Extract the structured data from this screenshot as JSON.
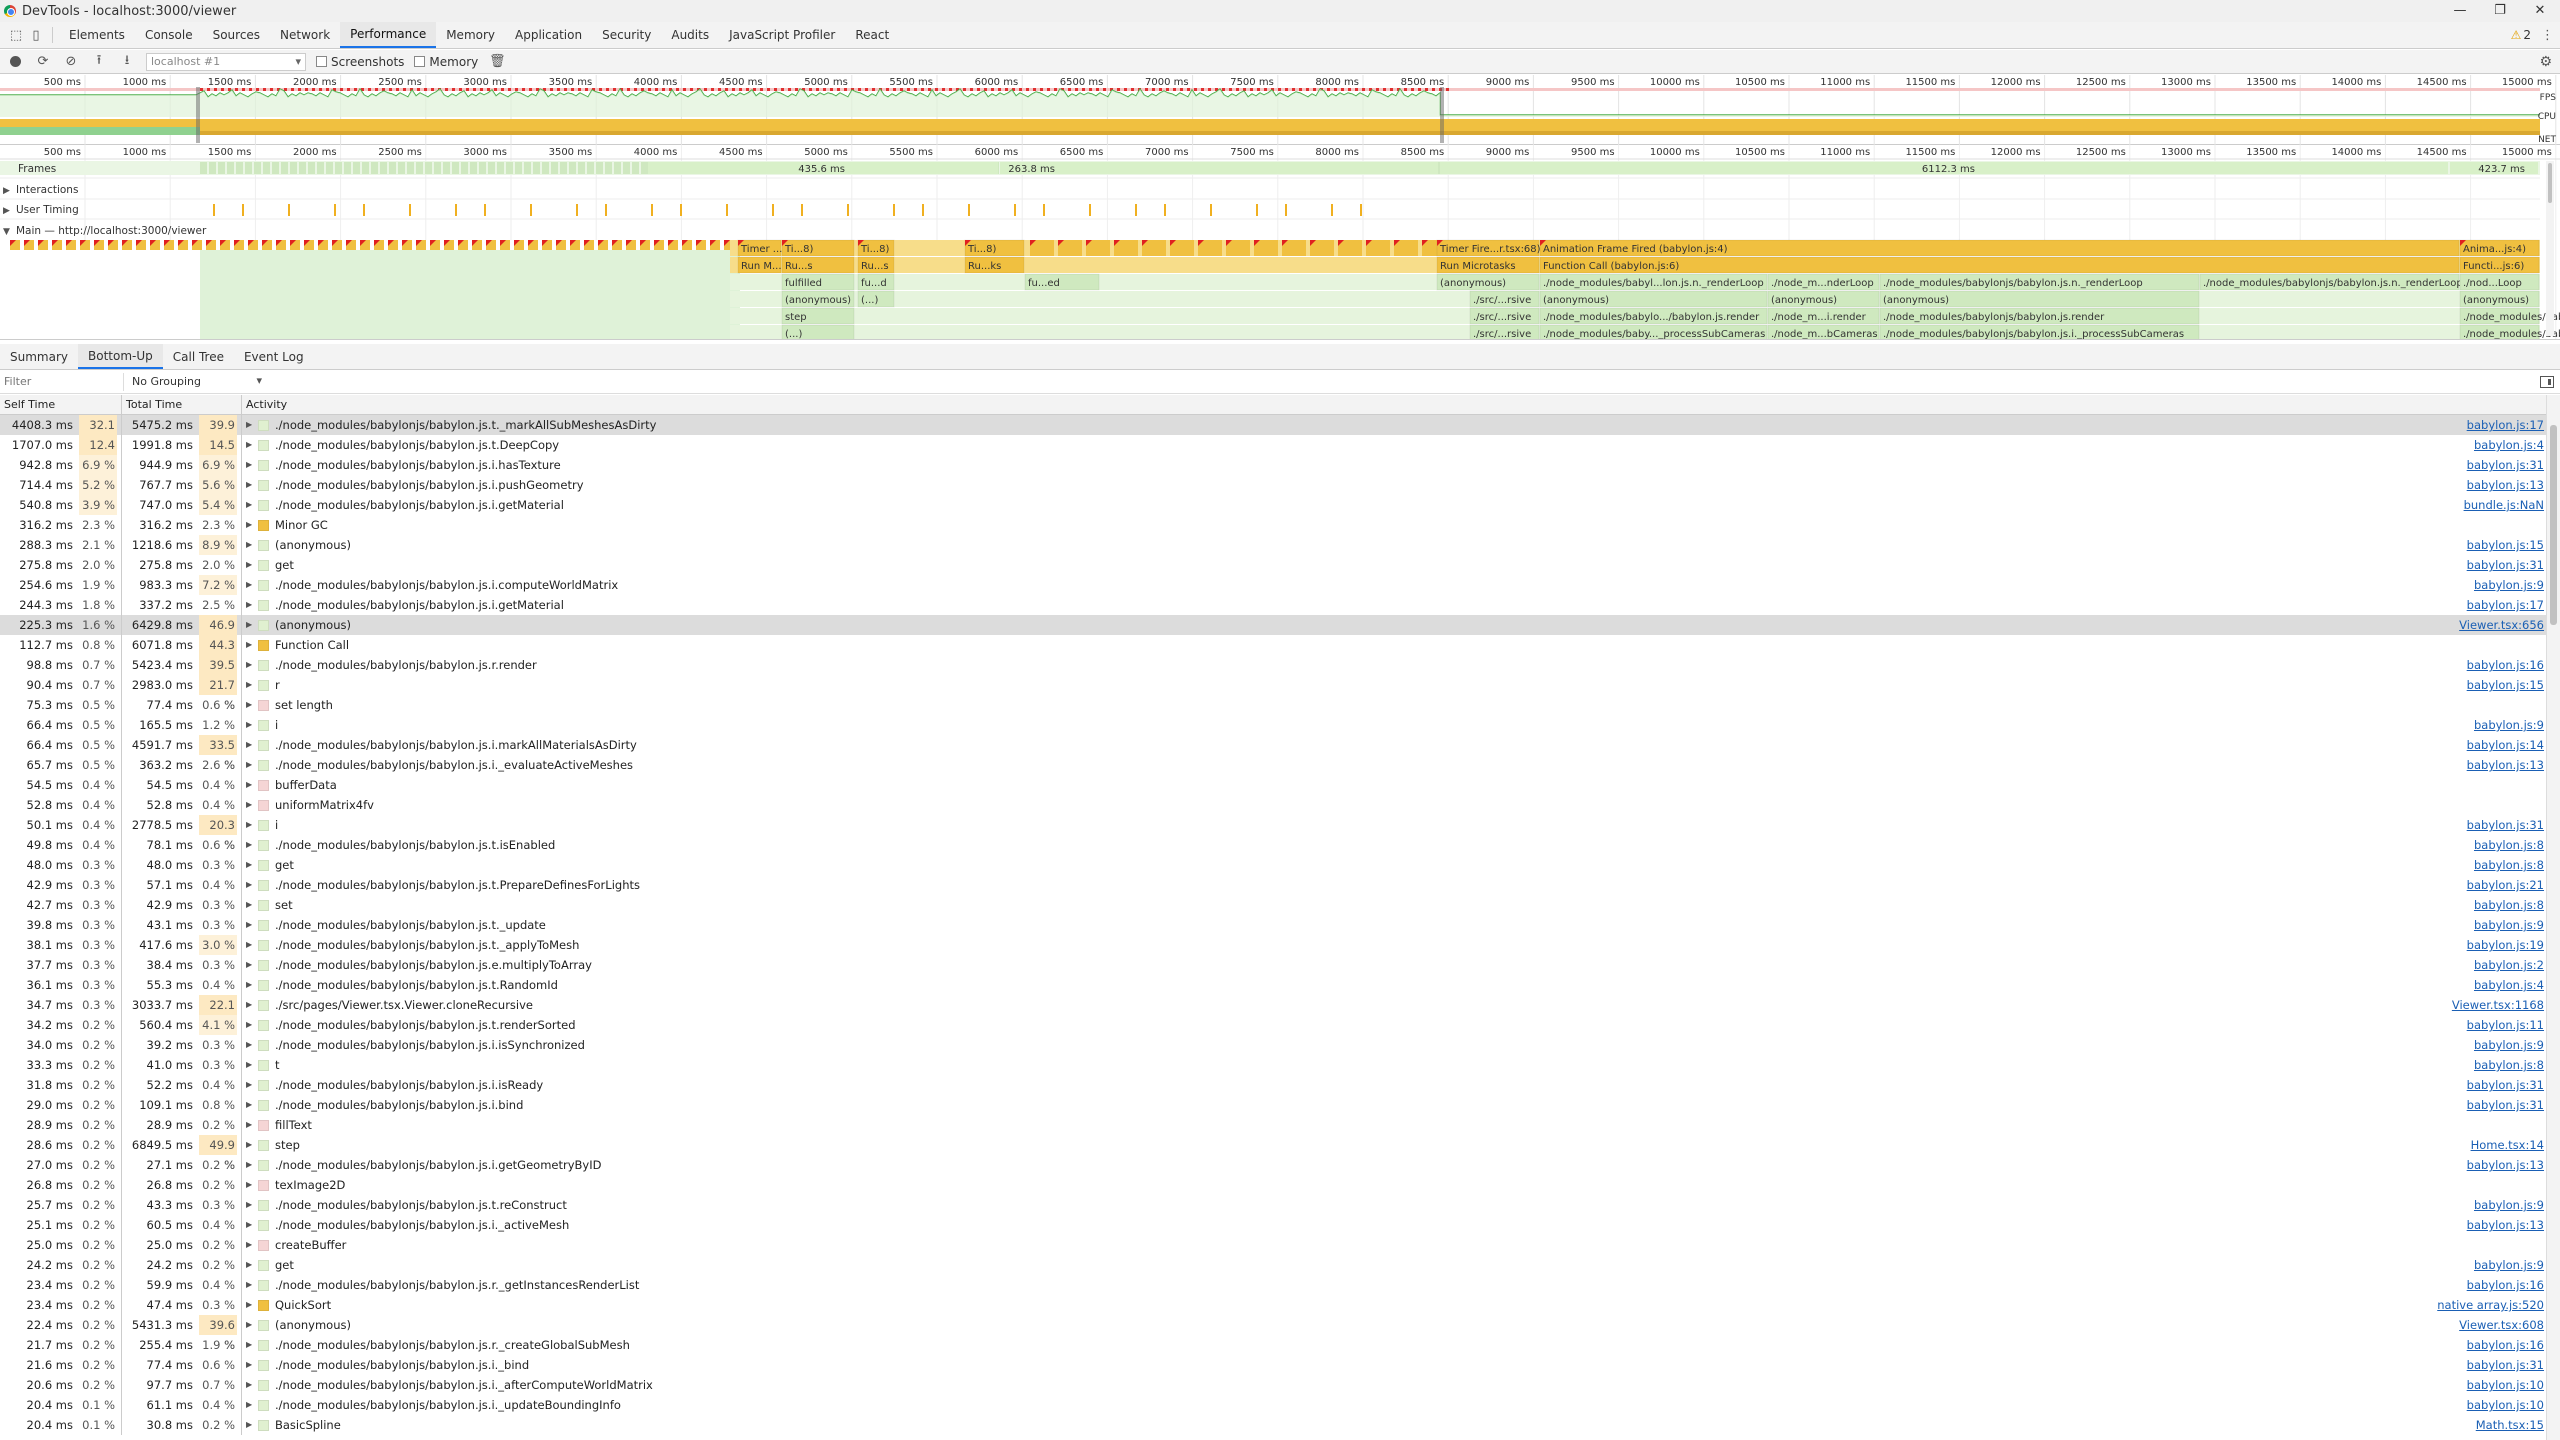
{
  "window": {
    "title": "DevTools - localhost:3000/viewer",
    "min": "—",
    "max": "❐",
    "close": "✕"
  },
  "tabs": [
    "Elements",
    "Console",
    "Sources",
    "Network",
    "Performance",
    "Memory",
    "Application",
    "Security",
    "Audits",
    "JavaScript Profiler",
    "React"
  ],
  "active_tab": "Performance",
  "warnings_count": "2",
  "toolbar": {
    "profile_select": "localhost #1",
    "screenshots_label": "Screenshots",
    "memory_label": "Memory"
  },
  "overview": {
    "ticks": [
      "500 ms",
      "1000 ms",
      "1500 ms",
      "2000 ms",
      "2500 ms",
      "3000 ms",
      "3500 ms",
      "4000 ms",
      "4500 ms",
      "5000 ms",
      "5500 ms",
      "6000 ms",
      "6500 ms",
      "7000 ms",
      "7500 ms",
      "8000 ms",
      "8500 ms",
      "9000 ms",
      "9500 ms",
      "10000 ms",
      "10500 ms",
      "11000 ms",
      "11500 ms",
      "12000 ms",
      "12500 ms",
      "13000 ms",
      "13500 ms",
      "14000 ms",
      "14500 ms",
      "15000 ms"
    ],
    "lanes": [
      "FPS",
      "CPU",
      "NET"
    ]
  },
  "timeline": {
    "ticks": [
      "500 ms",
      "1000 ms",
      "1500 ms",
      "2000 ms",
      "2500 ms",
      "3000 ms",
      "3500 ms",
      "4000 ms",
      "4500 ms",
      "5000 ms",
      "5500 ms",
      "6000 ms",
      "6500 ms",
      "7000 ms",
      "7500 ms",
      "8000 ms",
      "8500 ms",
      "9000 ms",
      "9500 ms",
      "10000 ms",
      "10500 ms",
      "11000 ms",
      "11500 ms",
      "12000 ms",
      "12500 ms",
      "13000 ms",
      "13500 ms",
      "14000 ms",
      "14500 ms",
      "15000 ms"
    ],
    "tracks": [
      "Frames",
      "Interactions",
      "User Timing",
      "Main — http://localhost:3000/viewer"
    ],
    "frame_labels": [
      "435.6 ms",
      "263.8 ms",
      "6112.3 ms",
      "423.7 ms"
    ],
    "flame_rows": [
      [
        "Timer ...ic68",
        "Ti...8)",
        "Ti...8)",
        "Ti...8)",
        "Timer Fire...r.tsx:68)",
        "Animation Frame Fired (babylon.js:4)",
        "Anima...js:4)"
      ],
      [
        "Run M...asks",
        "Ru...s",
        "Ru...s",
        "Ru...ks",
        "Run Microtasks",
        "Function Call (babylon.js:6)",
        "Functi...js:6)"
      ],
      [
        "fulfilled",
        "fu...d",
        "fu...ed",
        "(anonymous)",
        "./node_modules/babyl...lon.js.n._renderLoop",
        "./node_m...nderLoop",
        "./node_modules/babylonjs/babylon.js.n._renderLoop",
        "./node_modules/babylonjs/babylon.js.n._renderLoop",
        "./nod...Loop"
      ],
      [
        "(anonymous)",
        "(...)",
        "./src/...rsive",
        "(anonymous)",
        "(anonymous)",
        "(anonymous)",
        "(anonymous)",
        "(anon...ous)"
      ],
      [
        "step",
        "./src/...rsive",
        "./node_modules/babylo.../babylon.js.render",
        "./node_m...i.render",
        "./node_modules/babylonjs/babylon.js.render",
        "./node_modules/babylonjs/babylon.js.render",
        "./nod...nder"
      ],
      [
        "(...)",
        "./src/...rsive",
        "./node_modules/baby..._processSubCameras",
        "./node_m...bCameras",
        "./node_modules/babylonjs/babylon.js.i._processSubCameras",
        "./node_modules/babylonjs/babylon.js.i._processSubCameras",
        "./nod...eras"
      ]
    ]
  },
  "bottom_tabs": [
    "Summary",
    "Bottom-Up",
    "Call Tree",
    "Event Log"
  ],
  "active_bottom_tab": "Bottom-Up",
  "filter": {
    "placeholder": "Filter",
    "grouping": "No Grouping"
  },
  "table": {
    "headers": {
      "self": "Self Time",
      "total": "Total Time",
      "activity": "Activity"
    },
    "rows": [
      {
        "self": "4408.3 ms",
        "self_pct": "32.1 %",
        "total": "5475.2 ms",
        "total_pct": "39.9 %",
        "activity": "./node_modules/babylonjs/babylon.js.t._markAllSubMeshesAsDirty",
        "link": "babylon.js:17",
        "color": "#e0f0d0",
        "selected": true
      },
      {
        "self": "1707.0 ms",
        "self_pct": "12.4 %",
        "total": "1991.8 ms",
        "total_pct": "14.5 %",
        "activity": "./node_modules/babylonjs/babylon.js.t.DeepCopy",
        "link": "babylon.js:4",
        "color": "#e0f0d0"
      },
      {
        "self": "942.8 ms",
        "self_pct": "6.9 %",
        "total": "944.9 ms",
        "total_pct": "6.9 %",
        "activity": "./node_modules/babylonjs/babylon.js.i.hasTexture",
        "link": "babylon.js:31",
        "color": "#e0f0d0"
      },
      {
        "self": "714.4 ms",
        "self_pct": "5.2 %",
        "total": "767.7 ms",
        "total_pct": "5.6 %",
        "activity": "./node_modules/babylonjs/babylon.js.i.pushGeometry",
        "link": "babylon.js:13",
        "color": "#e0f0d0"
      },
      {
        "self": "540.8 ms",
        "self_pct": "3.9 %",
        "total": "747.0 ms",
        "total_pct": "5.4 %",
        "activity": "./node_modules/babylonjs/babylon.js.i.getMaterial",
        "link": "bundle.js:NaN",
        "color": "#e0f0d0"
      },
      {
        "self": "316.2 ms",
        "self_pct": "2.3 %",
        "total": "316.2 ms",
        "total_pct": "2.3 %",
        "activity": "Minor GC",
        "link": "",
        "color": "#f0c040"
      },
      {
        "self": "288.3 ms",
        "self_pct": "2.1 %",
        "total": "1218.6 ms",
        "total_pct": "8.9 %",
        "activity": "(anonymous)",
        "link": "babylon.js:15",
        "color": "#e0f0d0"
      },
      {
        "self": "275.8 ms",
        "self_pct": "2.0 %",
        "total": "275.8 ms",
        "total_pct": "2.0 %",
        "activity": "get",
        "link": "babylon.js:31",
        "color": "#e0f0d0"
      },
      {
        "self": "254.6 ms",
        "self_pct": "1.9 %",
        "total": "983.3 ms",
        "total_pct": "7.2 %",
        "activity": "./node_modules/babylonjs/babylon.js.i.computeWorldMatrix",
        "link": "babylon.js:9",
        "color": "#e0f0d0"
      },
      {
        "self": "244.3 ms",
        "self_pct": "1.8 %",
        "total": "337.2 ms",
        "total_pct": "2.5 %",
        "activity": "./node_modules/babylonjs/babylon.js.i.getMaterial",
        "link": "babylon.js:17",
        "color": "#e0f0d0"
      },
      {
        "self": "225.3 ms",
        "self_pct": "1.6 %",
        "total": "6429.8 ms",
        "total_pct": "46.9 %",
        "activity": "(anonymous)",
        "link": "Viewer.tsx:656",
        "color": "#e0f0d0",
        "selected": true
      },
      {
        "self": "112.7 ms",
        "self_pct": "0.8 %",
        "total": "6071.8 ms",
        "total_pct": "44.3 %",
        "activity": "Function Call",
        "link": "",
        "color": "#f0c040"
      },
      {
        "self": "98.8 ms",
        "self_pct": "0.7 %",
        "total": "5423.4 ms",
        "total_pct": "39.5 %",
        "activity": "./node_modules/babylonjs/babylon.js.r.render",
        "link": "babylon.js:16",
        "color": "#e0f0d0"
      },
      {
        "self": "90.4 ms",
        "self_pct": "0.7 %",
        "total": "2983.0 ms",
        "total_pct": "21.7 %",
        "activity": "r",
        "link": "babylon.js:15",
        "color": "#e0f0d0"
      },
      {
        "self": "75.3 ms",
        "self_pct": "0.5 %",
        "total": "77.4 ms",
        "total_pct": "0.6 %",
        "activity": "set length",
        "link": "",
        "color": "#f5d5d5"
      },
      {
        "self": "66.4 ms",
        "self_pct": "0.5 %",
        "total": "165.5 ms",
        "total_pct": "1.2 %",
        "activity": "i",
        "link": "babylon.js:9",
        "color": "#e0f0d0"
      },
      {
        "self": "66.4 ms",
        "self_pct": "0.5 %",
        "total": "4591.7 ms",
        "total_pct": "33.5 %",
        "activity": "./node_modules/babylonjs/babylon.js.i.markAllMaterialsAsDirty",
        "link": "babylon.js:14",
        "color": "#e0f0d0"
      },
      {
        "self": "65.7 ms",
        "self_pct": "0.5 %",
        "total": "363.2 ms",
        "total_pct": "2.6 %",
        "activity": "./node_modules/babylonjs/babylon.js.i._evaluateActiveMeshes",
        "link": "babylon.js:13",
        "color": "#e0f0d0"
      },
      {
        "self": "54.5 ms",
        "self_pct": "0.4 %",
        "total": "54.5 ms",
        "total_pct": "0.4 %",
        "activity": "bufferData",
        "link": "",
        "color": "#f5d5d5"
      },
      {
        "self": "52.8 ms",
        "self_pct": "0.4 %",
        "total": "52.8 ms",
        "total_pct": "0.4 %",
        "activity": "uniformMatrix4fv",
        "link": "",
        "color": "#f5d5d5"
      },
      {
        "self": "50.1 ms",
        "self_pct": "0.4 %",
        "total": "2778.5 ms",
        "total_pct": "20.3 %",
        "activity": "i",
        "link": "babylon.js:31",
        "color": "#e0f0d0"
      },
      {
        "self": "49.8 ms",
        "self_pct": "0.4 %",
        "total": "78.1 ms",
        "total_pct": "0.6 %",
        "activity": "./node_modules/babylonjs/babylon.js.t.isEnabled",
        "link": "babylon.js:8",
        "color": "#e0f0d0"
      },
      {
        "self": "48.0 ms",
        "self_pct": "0.3 %",
        "total": "48.0 ms",
        "total_pct": "0.3 %",
        "activity": "get",
        "link": "babylon.js:8",
        "color": "#e0f0d0"
      },
      {
        "self": "42.9 ms",
        "self_pct": "0.3 %",
        "total": "57.1 ms",
        "total_pct": "0.4 %",
        "activity": "./node_modules/babylonjs/babylon.js.t.PrepareDefinesForLights",
        "link": "babylon.js:21",
        "color": "#e0f0d0"
      },
      {
        "self": "42.7 ms",
        "self_pct": "0.3 %",
        "total": "42.9 ms",
        "total_pct": "0.3 %",
        "activity": "set",
        "link": "babylon.js:8",
        "color": "#e0f0d0"
      },
      {
        "self": "39.8 ms",
        "self_pct": "0.3 %",
        "total": "43.1 ms",
        "total_pct": "0.3 %",
        "activity": "./node_modules/babylonjs/babylon.js.t._update",
        "link": "babylon.js:9",
        "color": "#e0f0d0"
      },
      {
        "self": "38.1 ms",
        "self_pct": "0.3 %",
        "total": "417.6 ms",
        "total_pct": "3.0 %",
        "activity": "./node_modules/babylonjs/babylon.js.t._applyToMesh",
        "link": "babylon.js:19",
        "color": "#e0f0d0"
      },
      {
        "self": "37.7 ms",
        "self_pct": "0.3 %",
        "total": "38.4 ms",
        "total_pct": "0.3 %",
        "activity": "./node_modules/babylonjs/babylon.js.e.multiplyToArray",
        "link": "babylon.js:2",
        "color": "#e0f0d0"
      },
      {
        "self": "36.1 ms",
        "self_pct": "0.3 %",
        "total": "55.3 ms",
        "total_pct": "0.4 %",
        "activity": "./node_modules/babylonjs/babylon.js.t.RandomId",
        "link": "babylon.js:4",
        "color": "#e0f0d0"
      },
      {
        "self": "34.7 ms",
        "self_pct": "0.3 %",
        "total": "3033.7 ms",
        "total_pct": "22.1 %",
        "activity": "./src/pages/Viewer.tsx.Viewer.cloneRecursive",
        "link": "Viewer.tsx:1168",
        "color": "#e0f0d0"
      },
      {
        "self": "34.2 ms",
        "self_pct": "0.2 %",
        "total": "560.4 ms",
        "total_pct": "4.1 %",
        "activity": "./node_modules/babylonjs/babylon.js.t.renderSorted",
        "link": "babylon.js:11",
        "color": "#e0f0d0"
      },
      {
        "self": "34.0 ms",
        "self_pct": "0.2 %",
        "total": "39.2 ms",
        "total_pct": "0.3 %",
        "activity": "./node_modules/babylonjs/babylon.js.i.isSynchronized",
        "link": "babylon.js:9",
        "color": "#e0f0d0"
      },
      {
        "self": "33.3 ms",
        "self_pct": "0.2 %",
        "total": "41.0 ms",
        "total_pct": "0.3 %",
        "activity": "t",
        "link": "babylon.js:8",
        "color": "#e0f0d0"
      },
      {
        "self": "31.8 ms",
        "self_pct": "0.2 %",
        "total": "52.2 ms",
        "total_pct": "0.4 %",
        "activity": "./node_modules/babylonjs/babylon.js.i.isReady",
        "link": "babylon.js:31",
        "color": "#e0f0d0"
      },
      {
        "self": "29.0 ms",
        "self_pct": "0.2 %",
        "total": "109.1 ms",
        "total_pct": "0.8 %",
        "activity": "./node_modules/babylonjs/babylon.js.i.bind",
        "link": "babylon.js:31",
        "color": "#e0f0d0"
      },
      {
        "self": "28.9 ms",
        "self_pct": "0.2 %",
        "total": "28.9 ms",
        "total_pct": "0.2 %",
        "activity": "fillText",
        "link": "",
        "color": "#f5d5d5"
      },
      {
        "self": "28.6 ms",
        "self_pct": "0.2 %",
        "total": "6849.5 ms",
        "total_pct": "49.9 %",
        "activity": "step",
        "link": "Home.tsx:14",
        "color": "#e0f0d0"
      },
      {
        "self": "27.0 ms",
        "self_pct": "0.2 %",
        "total": "27.1 ms",
        "total_pct": "0.2 %",
        "activity": "./node_modules/babylonjs/babylon.js.i.getGeometryByID",
        "link": "babylon.js:13",
        "color": "#e0f0d0"
      },
      {
        "self": "26.8 ms",
        "self_pct": "0.2 %",
        "total": "26.8 ms",
        "total_pct": "0.2 %",
        "activity": "texImage2D",
        "link": "",
        "color": "#f5d5d5"
      },
      {
        "self": "25.7 ms",
        "self_pct": "0.2 %",
        "total": "43.3 ms",
        "total_pct": "0.3 %",
        "activity": "./node_modules/babylonjs/babylon.js.t.reConstruct",
        "link": "babylon.js:9",
        "color": "#e0f0d0"
      },
      {
        "self": "25.1 ms",
        "self_pct": "0.2 %",
        "total": "60.5 ms",
        "total_pct": "0.4 %",
        "activity": "./node_modules/babylonjs/babylon.js.i._activeMesh",
        "link": "babylon.js:13",
        "color": "#e0f0d0"
      },
      {
        "self": "25.0 ms",
        "self_pct": "0.2 %",
        "total": "25.0 ms",
        "total_pct": "0.2 %",
        "activity": "createBuffer",
        "link": "",
        "color": "#f5d5d5"
      },
      {
        "self": "24.2 ms",
        "self_pct": "0.2 %",
        "total": "24.2 ms",
        "total_pct": "0.2 %",
        "activity": "get",
        "link": "babylon.js:9",
        "color": "#e0f0d0"
      },
      {
        "self": "23.4 ms",
        "self_pct": "0.2 %",
        "total": "59.9 ms",
        "total_pct": "0.4 %",
        "activity": "./node_modules/babylonjs/babylon.js.r._getInstancesRenderList",
        "link": "babylon.js:16",
        "color": "#e0f0d0"
      },
      {
        "self": "23.4 ms",
        "self_pct": "0.2 %",
        "total": "47.4 ms",
        "total_pct": "0.3 %",
        "activity": "QuickSort",
        "link": "native array.js:520",
        "color": "#f0c040"
      },
      {
        "self": "22.4 ms",
        "self_pct": "0.2 %",
        "total": "5431.3 ms",
        "total_pct": "39.6 %",
        "activity": "(anonymous)",
        "link": "Viewer.tsx:608",
        "color": "#e0f0d0"
      },
      {
        "self": "21.7 ms",
        "self_pct": "0.2 %",
        "total": "255.4 ms",
        "total_pct": "1.9 %",
        "activity": "./node_modules/babylonjs/babylon.js.r._createGlobalSubMesh",
        "link": "babylon.js:16",
        "color": "#e0f0d0"
      },
      {
        "self": "21.6 ms",
        "self_pct": "0.2 %",
        "total": "77.4 ms",
        "total_pct": "0.6 %",
        "activity": "./node_modules/babylonjs/babylon.js.i._bind",
        "link": "babylon.js:31",
        "color": "#e0f0d0"
      },
      {
        "self": "20.6 ms",
        "self_pct": "0.2 %",
        "total": "97.7 ms",
        "total_pct": "0.7 %",
        "activity": "./node_modules/babylonjs/babylon.js.i._afterComputeWorldMatrix",
        "link": "babylon.js:10",
        "color": "#e0f0d0"
      },
      {
        "self": "20.4 ms",
        "self_pct": "0.1 %",
        "total": "61.1 ms",
        "total_pct": "0.4 %",
        "activity": "./node_modules/babylonjs/babylon.js.i._updateBoundingInfo",
        "link": "babylon.js:10",
        "color": "#e0f0d0"
      },
      {
        "self": "20.4 ms",
        "self_pct": "0.1 %",
        "total": "30.8 ms",
        "total_pct": "0.2 %",
        "activity": "BasicSpline",
        "link": "Math.tsx:15",
        "color": "#e0f0d0"
      }
    ]
  },
  "colors": {
    "accent": "#1a73e8",
    "scripting": "#f0c040",
    "painting": "#8fd18f",
    "frames": "#d8f0c8",
    "long_task": "#e02020"
  }
}
